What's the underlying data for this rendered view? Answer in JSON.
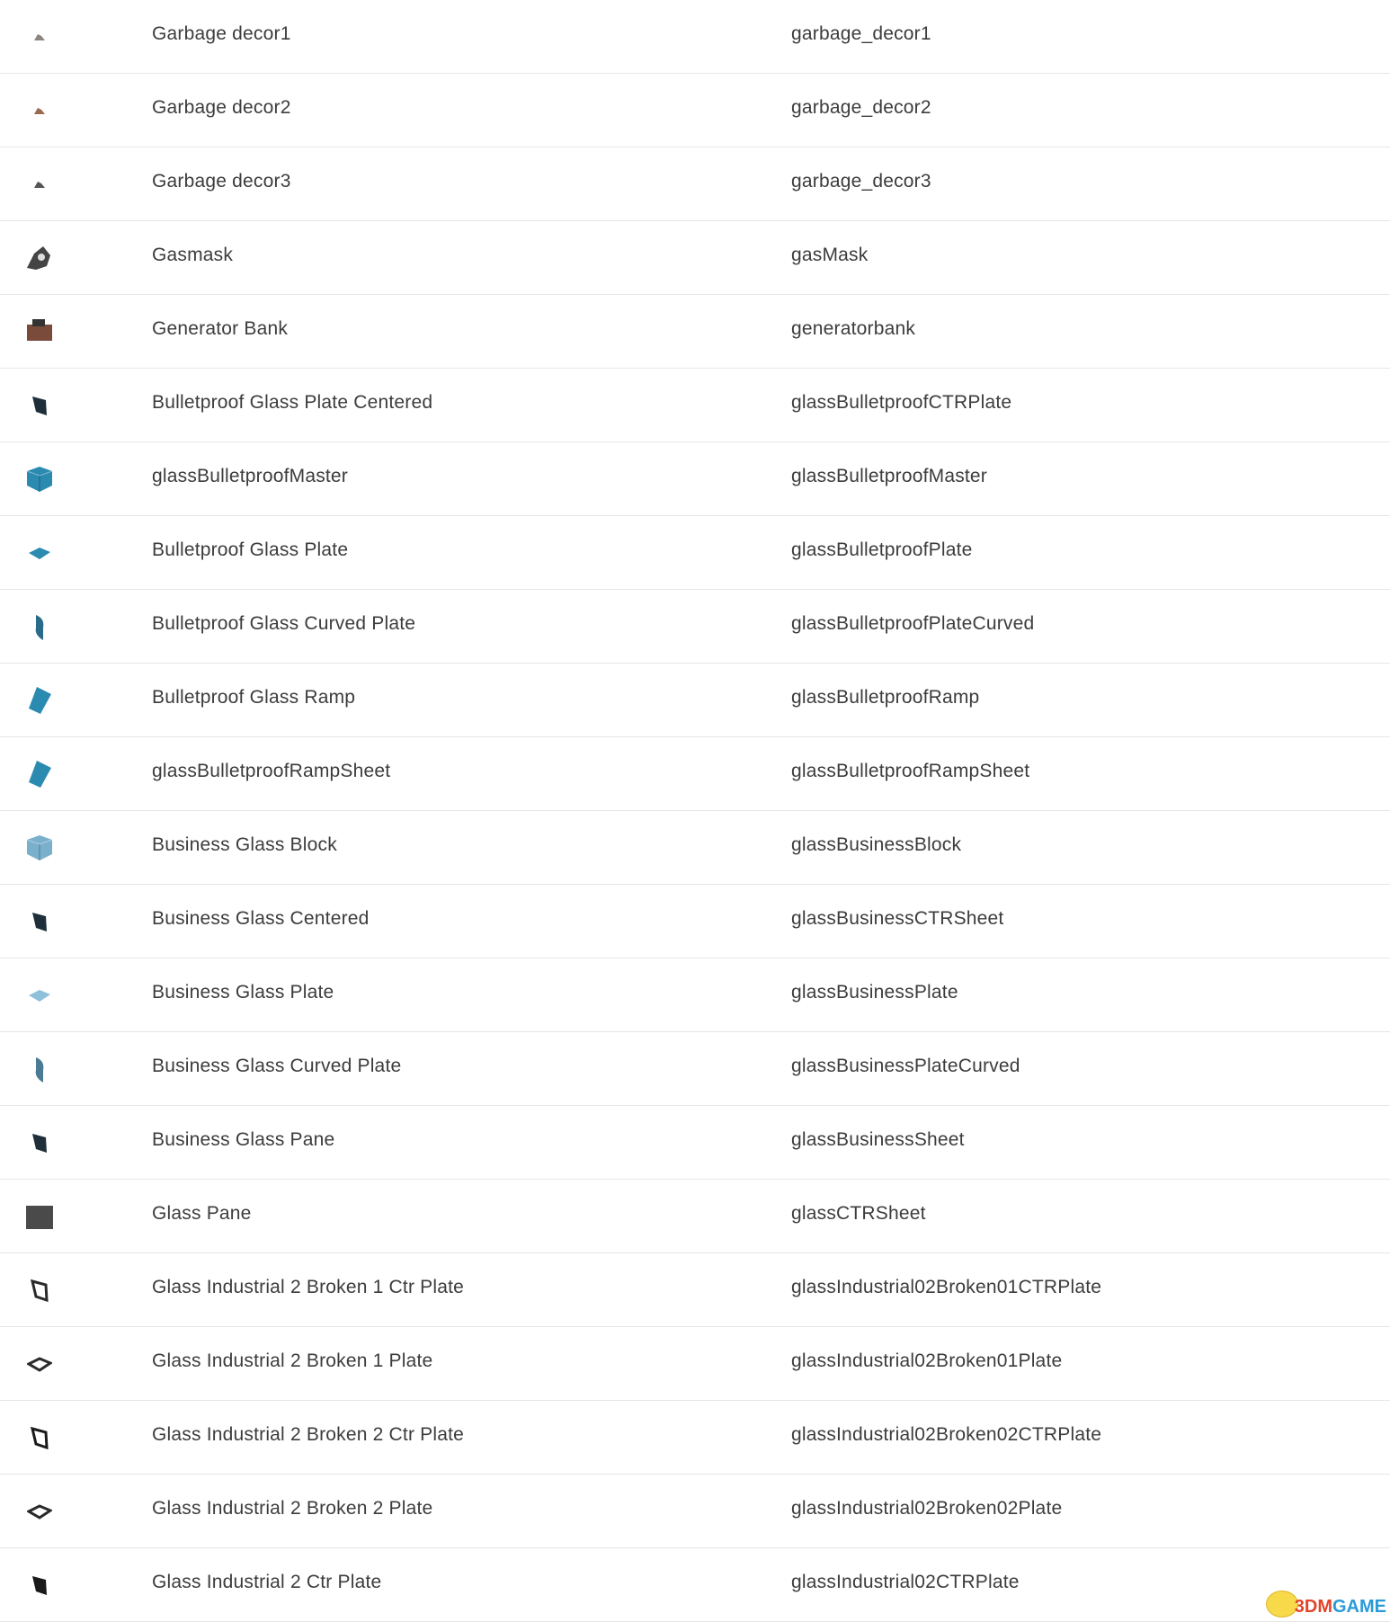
{
  "items": [
    {
      "name": "Garbage decor1",
      "code": "garbage_decor1",
      "icon": "debris-icon",
      "color": "#8a8580"
    },
    {
      "name": "Garbage decor2",
      "code": "garbage_decor2",
      "icon": "debris-icon",
      "color": "#9a6a50"
    },
    {
      "name": "Garbage decor3",
      "code": "garbage_decor3",
      "icon": "debris-icon",
      "color": "#555555"
    },
    {
      "name": "Gasmask",
      "code": "gasMask",
      "icon": "gasmask-icon",
      "color": "#444444"
    },
    {
      "name": "Generator Bank",
      "code": "generatorbank",
      "icon": "generator-icon",
      "color": "#7a4a3a"
    },
    {
      "name": "Bulletproof Glass Plate Centered",
      "code": "glassBulletproofCTRPlate",
      "icon": "glass-plate-icon",
      "color": "#1f2f3a"
    },
    {
      "name": "glassBulletproofMaster",
      "code": "glassBulletproofMaster",
      "icon": "glass-block-icon",
      "color": "#2a8ab0"
    },
    {
      "name": "Bulletproof Glass Plate",
      "code": "glassBulletproofPlate",
      "icon": "glass-flat-icon",
      "color": "#2a8ab0"
    },
    {
      "name": "Bulletproof Glass Curved Plate",
      "code": "glassBulletproofPlateCurved",
      "icon": "glass-curved-icon",
      "color": "#2a6a8a"
    },
    {
      "name": "Bulletproof Glass Ramp",
      "code": "glassBulletproofRamp",
      "icon": "glass-ramp-icon",
      "color": "#2a8ab0"
    },
    {
      "name": "glassBulletproofRampSheet",
      "code": "glassBulletproofRampSheet",
      "icon": "glass-ramp-icon",
      "color": "#2a8ab0"
    },
    {
      "name": "Business Glass Block",
      "code": "glassBusinessBlock",
      "icon": "glass-block-icon",
      "color": "#7ab0cc"
    },
    {
      "name": "Business Glass Centered",
      "code": "glassBusinessCTRSheet",
      "icon": "glass-plate-icon",
      "color": "#1f2f3a"
    },
    {
      "name": "Business Glass Plate",
      "code": "glassBusinessPlate",
      "icon": "glass-flat-icon",
      "color": "#8ec0dc"
    },
    {
      "name": "Business Glass Curved Plate",
      "code": "glassBusinessPlateCurved",
      "icon": "glass-curved-icon",
      "color": "#4a7a94"
    },
    {
      "name": "Business Glass Pane",
      "code": "glassBusinessSheet",
      "icon": "glass-plate-icon",
      "color": "#1f2f3a"
    },
    {
      "name": "Glass Pane",
      "code": "glassCTRSheet",
      "icon": "glass-pane-icon",
      "color": "#4a4a4a"
    },
    {
      "name": "Glass Industrial 2 Broken 1 Ctr Plate",
      "code": "glassIndustrial02Broken01CTRPlate",
      "icon": "broken-glass-icon",
      "color": "#2a2a2a"
    },
    {
      "name": "Glass Industrial 2 Broken 1 Plate",
      "code": "glassIndustrial02Broken01Plate",
      "icon": "broken-glass-flat-icon",
      "color": "#2a2a2a"
    },
    {
      "name": "Glass Industrial 2 Broken 2 Ctr Plate",
      "code": "glassIndustrial02Broken02CTRPlate",
      "icon": "broken-glass-icon",
      "color": "#1a1a1a"
    },
    {
      "name": "Glass Industrial 2 Broken 2 Plate",
      "code": "glassIndustrial02Broken02Plate",
      "icon": "broken-glass-flat-icon",
      "color": "#2a2a2a"
    },
    {
      "name": "Glass Industrial 2 Ctr Plate",
      "code": "glassIndustrial02CTRPlate",
      "icon": "glass-plate-icon",
      "color": "#1a1a1a"
    }
  ],
  "watermark": {
    "text": "3DMGAME",
    "colors": [
      "#e0452a",
      "#2a9ad8"
    ]
  }
}
